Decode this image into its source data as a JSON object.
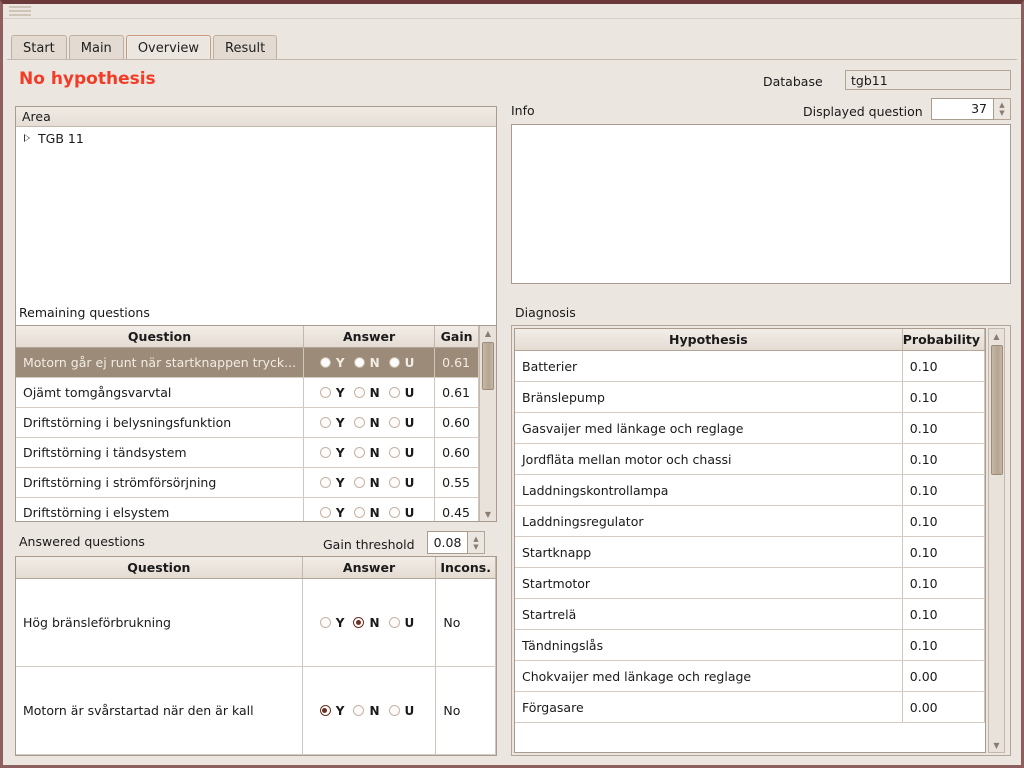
{
  "window": {
    "title": ""
  },
  "tabs": [
    {
      "label": "Start",
      "selected": false
    },
    {
      "label": "Main",
      "selected": false
    },
    {
      "label": "Overview",
      "selected": true
    },
    {
      "label": "Result",
      "selected": false
    }
  ],
  "status": {
    "hypothesis_text": "No hypothesis",
    "hypothesis_color": "#f23c28"
  },
  "database": {
    "label": "Database",
    "value": "tgb11"
  },
  "info": {
    "label": "Info",
    "content": ""
  },
  "displayed_question": {
    "label": "Displayed question",
    "value": "37"
  },
  "area": {
    "header": "Area",
    "nodes": [
      {
        "label": "TGB 11",
        "expanded": false
      }
    ]
  },
  "remaining": {
    "label": "Remaining questions",
    "columns": [
      "Question",
      "Answer",
      "Gain"
    ],
    "rows": [
      {
        "question": "Motorn går ej runt när startknappen tryck...",
        "answer": "",
        "gain": "0.61",
        "selected": true
      },
      {
        "question": "Ojämt tomgångsvarvtal",
        "answer": "",
        "gain": "0.61",
        "selected": false
      },
      {
        "question": "Driftstörning i belysningsfunktion",
        "answer": "",
        "gain": "0.60",
        "selected": false
      },
      {
        "question": "Driftstörning i tändsystem",
        "answer": "",
        "gain": "0.60",
        "selected": false
      },
      {
        "question": "Driftstörning i strömförsörjning",
        "answer": "",
        "gain": "0.55",
        "selected": false
      },
      {
        "question": "Driftstörning i elsystem",
        "answer": "",
        "gain": "0.45",
        "selected": false
      }
    ],
    "answer_options": [
      "Y",
      "N",
      "U"
    ]
  },
  "gain_threshold": {
    "label": "Gain threshold",
    "value": "0.08"
  },
  "answered": {
    "label": "Answered questions",
    "columns": [
      "Question",
      "Answer",
      "Incons."
    ],
    "rows": [
      {
        "question": "Hög bränsleförbrukning",
        "answer": "N",
        "incons": "No"
      },
      {
        "question": "Motorn är svårstartad när den är kall",
        "answer": "Y",
        "incons": "No"
      }
    ],
    "answer_options": [
      "Y",
      "N",
      "U"
    ]
  },
  "diagnosis": {
    "label": "Diagnosis",
    "columns": [
      "Hypothesis",
      "Probability"
    ],
    "rows": [
      {
        "hypothesis": "Batterier",
        "probability": "0.10"
      },
      {
        "hypothesis": "Bränslepump",
        "probability": "0.10"
      },
      {
        "hypothesis": "Gasvaijer med länkage och reglage",
        "probability": "0.10"
      },
      {
        "hypothesis": "Jordfläta mellan motor och chassi",
        "probability": "0.10"
      },
      {
        "hypothesis": "Laddningskontrollampa",
        "probability": "0.10"
      },
      {
        "hypothesis": "Laddningsregulator",
        "probability": "0.10"
      },
      {
        "hypothesis": "Startknapp",
        "probability": "0.10"
      },
      {
        "hypothesis": "Startmotor",
        "probability": "0.10"
      },
      {
        "hypothesis": "Startrelä",
        "probability": "0.10"
      },
      {
        "hypothesis": "Tändningslås",
        "probability": "0.10"
      },
      {
        "hypothesis": "Chokvaijer med länkage och reglage",
        "probability": "0.00"
      },
      {
        "hypothesis": "Förgasare",
        "probability": "0.00"
      }
    ]
  },
  "icons": {
    "scroll_up": "▲",
    "scroll_down": "▼",
    "spin_up": "▲",
    "spin_down": "▼",
    "tree_collapsed": "▷"
  },
  "colors": {
    "window_border": "#6b3b3b",
    "background": "#ece6e0",
    "selection": "#9b8b78",
    "radio_on": "#6b2f22",
    "alert": "#f23c28"
  }
}
